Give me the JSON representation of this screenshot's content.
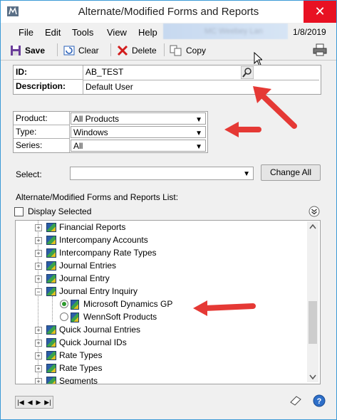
{
  "window": {
    "title": "Alternate/Modified Forms and Reports",
    "close_glyph": "✕"
  },
  "menu": {
    "items": [
      "File",
      "Edit",
      "Tools",
      "View",
      "Help"
    ],
    "date": "1/8/2019",
    "blurred_text": "MC Weebey Lan"
  },
  "toolbar": {
    "save": "Save",
    "clear": "Clear",
    "delete": "Delete",
    "copy": "Copy"
  },
  "form": {
    "id_label": "ID:",
    "id_value": "AB_TEST",
    "description_label": "Description:",
    "description_value": "Default User",
    "product_label": "Product:",
    "product_value": "All Products",
    "type_label": "Type:",
    "type_value": "Windows",
    "series_label": "Series:",
    "series_value": "All",
    "select_label": "Select:",
    "select_value": "",
    "change_all": "Change All",
    "list_title": "Alternate/Modified Forms and Reports List:",
    "display_selected": "Display Selected"
  },
  "tree": {
    "rows": [
      {
        "label": "Financial Reports",
        "type": "node"
      },
      {
        "label": "Intercompany Accounts",
        "type": "node"
      },
      {
        "label": "Intercompany Rate Types",
        "type": "node"
      },
      {
        "label": "Journal Entries",
        "type": "node"
      },
      {
        "label": "Journal Entry",
        "type": "node"
      },
      {
        "label": "Journal Entry Inquiry",
        "type": "node-open"
      },
      {
        "label": "Microsoft Dynamics GP",
        "type": "radio-on"
      },
      {
        "label": "WennSoft Products",
        "type": "radio-off"
      },
      {
        "label": "Quick Journal Entries",
        "type": "node"
      },
      {
        "label": "Quick Journal IDs",
        "type": "node"
      },
      {
        "label": "Rate Types",
        "type": "node"
      },
      {
        "label": "Rate Types",
        "type": "node"
      },
      {
        "label": "Segments",
        "type": "node"
      }
    ]
  },
  "colors": {
    "accent": "#e81123",
    "arrow": "#e53935"
  }
}
